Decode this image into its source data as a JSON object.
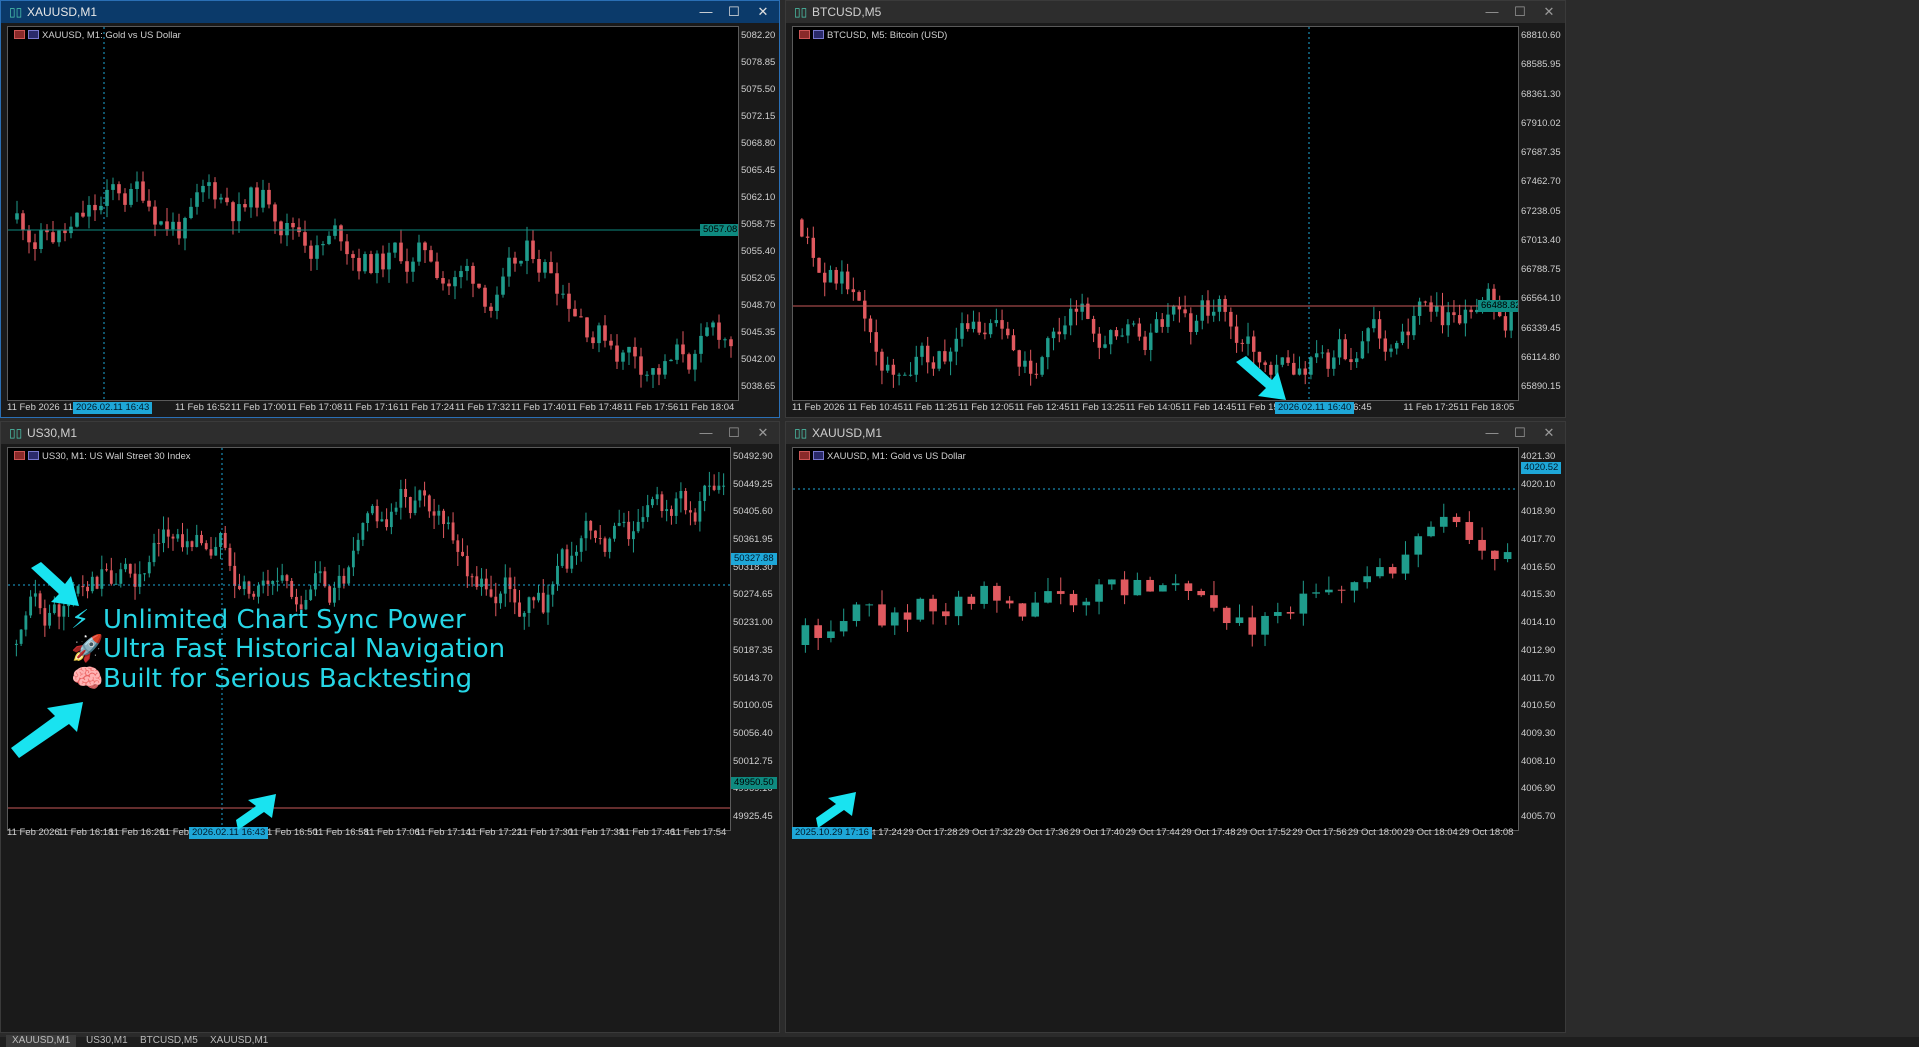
{
  "windows": [
    {
      "title": "XAUUSD,M1",
      "chart_label": "XAUUSD, M1:  Gold vs US Dollar",
      "yticks": [
        "5082.20",
        "5078.85",
        "5075.50",
        "5072.15",
        "5068.80",
        "5065.45",
        "5062.10",
        "5058.75",
        "5055.40",
        "5052.05",
        "5048.70",
        "5045.35",
        "5042.00",
        "5038.65"
      ],
      "xticks": [
        "11 Feb 2026",
        "11 F",
        "16:44",
        "11 Feb 16:52",
        "11 Feb 17:00",
        "11 Feb 17:08",
        "11 Feb 17:16",
        "11 Feb 17:24",
        "11 Feb 17:32",
        "11 Feb 17:40",
        "11 Feb 17:48",
        "11 Feb 17:56",
        "11 Feb 18:04"
      ],
      "crosshair_time": "2026.02.11 16:43",
      "price_tag": "5057.08"
    },
    {
      "title": "BTCUSD,M5",
      "chart_label": "BTCUSD, M5:  Bitcoin (USD)",
      "yticks": [
        "68810.60",
        "68585.95",
        "68361.30",
        "67910.02",
        "67687.35",
        "67462.70",
        "67238.05",
        "67013.40",
        "66788.75",
        "66564.10",
        "66339.45",
        "66114.80",
        "65890.15"
      ],
      "xticks": [
        "11 Feb 2026",
        "11 Feb 10:45",
        "11 Feb 11:25",
        "11 Feb 12:05",
        "11 Feb 12:45",
        "11 Feb 13:25",
        "11 Feb 14:05",
        "11 Feb 14:45",
        "11 Feb 15:25",
        "11 F",
        "16:45",
        "11 Feb 17:25",
        "11 Feb 18:05"
      ],
      "crosshair_time": "2026.02.11 16:40",
      "price_tag": "66488.82"
    },
    {
      "title": "US30,M1",
      "chart_label": "US30, M1:  US Wall Street 30 Index",
      "yticks": [
        "50492.90",
        "50449.25",
        "50405.60",
        "50361.95",
        "50318.30",
        "50274.65",
        "50231.00",
        "50187.35",
        "50143.70",
        "50100.05",
        "50056.40",
        "50012.75",
        "49969.10",
        "49925.45"
      ],
      "xticks": [
        "11 Feb 2026",
        "11 Feb 16:18",
        "11 Feb 16:26",
        "11 Feb",
        "2",
        "11 Feb 16:50",
        "11 Feb 16:58",
        "11 Feb 17:06",
        "11 Feb 17:14",
        "11 Feb 17:22",
        "11 Feb 17:30",
        "11 Feb 17:38",
        "11 Feb 17:46",
        "11 Feb 17:54"
      ],
      "crosshair_time": "2026.02.11 16:43",
      "crosshair_price": "50327.88",
      "price_tag": "49950.50"
    },
    {
      "title": "XAUUSD,M1",
      "chart_label": "XAUUSD, M1:  Gold vs US Dollar",
      "yticks": [
        "4021.30",
        "4020.10",
        "4018.90",
        "4017.70",
        "4016.50",
        "4015.30",
        "4014.10",
        "4012.90",
        "4011.70",
        "4010.50",
        "4009.30",
        "4008.10",
        "4006.90",
        "4005.70"
      ],
      "xticks": [
        "ct 17:20",
        "29 Oct 17:24",
        "29 Oct 17:28",
        "29 Oct 17:32",
        "29 Oct 17:36",
        "29 Oct 17:40",
        "29 Oct 17:44",
        "29 Oct 17:48",
        "29 Oct 17:52",
        "29 Oct 17:56",
        "29 Oct 18:00",
        "29 Oct 18:04",
        "29 Oct 18:08"
      ],
      "crosshair_time": "2025.10.29 17:16",
      "crosshair_price": "4020.52"
    }
  ],
  "promo": [
    {
      "emoji": "⚡",
      "text": "Unlimited Chart Sync Power"
    },
    {
      "emoji": "🚀",
      "text": "Ultra Fast Historical Navigation"
    },
    {
      "emoji": "🧠",
      "text": "Built for Serious Backtesting"
    }
  ],
  "tabs": [
    "XAUUSD,M1",
    "US30,M1",
    "BTCUSD,M5",
    "XAUUSD,M1"
  ],
  "colors": {
    "bull": "#1f9c8c",
    "bear": "#e0595f",
    "crosshair": "#1ea7d8",
    "arrow": "#19e3f0"
  },
  "window_buttons": {
    "minimize": "—",
    "maximize": "☐",
    "close": "✕"
  }
}
